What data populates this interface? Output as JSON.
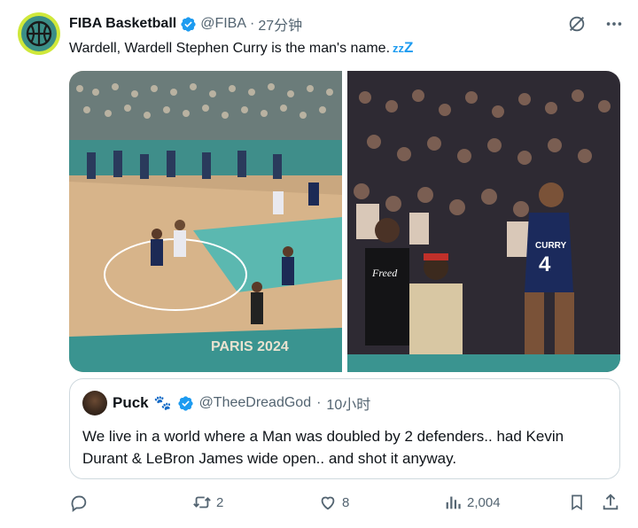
{
  "author": {
    "display_name": "FIBA Basketball",
    "handle": "@FIBA",
    "separator": "·",
    "time": "27分钟",
    "avatar_icon": "basketball-icon",
    "brand_color": "#cfe83a"
  },
  "tweet": {
    "text": "Wardell, Wardell Stephen Curry is the man's name.",
    "emoji_small": "zz",
    "emoji_big": "Z"
  },
  "media": [
    {
      "description_icon": "basketball-court-photo",
      "arena_text": "PARIS 2024"
    },
    {
      "description_icon": "crowd-celebration-photo",
      "jersey_name": "CURRY",
      "jersey_number": "4",
      "shirt_text": "Freed"
    }
  ],
  "quoted": {
    "display_name": "Puck",
    "emoji": "🐾",
    "handle": "@TheeDreadGod",
    "separator": "·",
    "time": "10小时",
    "text": "We live in a world where a Man was doubled by 2 defenders.. had Kevin Durant & LeBron James wide open.. and shot it anyway."
  },
  "actions": {
    "retweets": "2",
    "likes": "8",
    "views": "2,004"
  },
  "colors": {
    "verified": "#1d9bf0",
    "muted_text": "#536471",
    "border": "#cfd9de"
  }
}
